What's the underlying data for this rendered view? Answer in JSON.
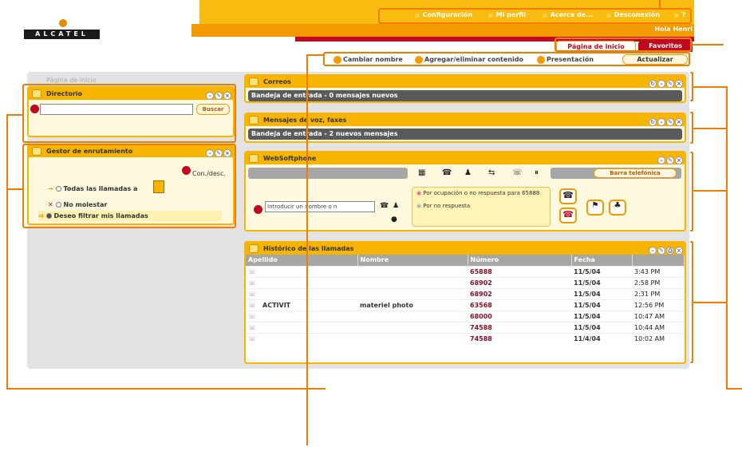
{
  "header": {
    "logo_text": "ALCATEL",
    "top_links": [
      "Configuración",
      "Mi perfil",
      "Acerca de...",
      "Desconexión",
      "?"
    ],
    "greeting": "Hola Henri",
    "tabs": [
      "Página de inicio",
      "Favoritos"
    ],
    "actions": [
      "Cambiar nombre",
      "Agregar/eliminar contenido",
      "Presentación"
    ],
    "refresh_label": "Actualizar"
  },
  "page_subtitle": "Página de inicio",
  "directorio": {
    "title": "Directorio",
    "search_button": "Buscar"
  },
  "gestor": {
    "title": "Gestor de enrutamiento",
    "toggle_label": "Con./desc.",
    "options": [
      "Todas las llamadas a",
      "No molestar",
      "Deseo filtrar mis llamadas"
    ]
  },
  "correos": {
    "title": "Correos",
    "bar": "Bandeja de entrada - 0 mensajes nuevos"
  },
  "voz": {
    "title": "Mensajes de voz, faxes",
    "bar": "Bandeja de entrada - 2 nuevos mensajes"
  },
  "softphone": {
    "title": "WebSoftphone",
    "barra_label": "Barra telefónica",
    "input_placeholder": "Introducir un nombre o n",
    "forward_rules": [
      "Por ocupación o no respuesta para 65888",
      "Por no respuesta"
    ]
  },
  "historico": {
    "title": "Histórico de las llamadas",
    "columns": [
      "Apellido",
      "Nombre",
      "Número",
      "Fecha",
      ""
    ],
    "rows": [
      {
        "apellido": "",
        "nombre": "",
        "numero": "65888",
        "fecha": "11/5/04",
        "hora": "3:43 PM"
      },
      {
        "apellido": "",
        "nombre": "",
        "numero": "68902",
        "fecha": "11/5/04",
        "hora": "2:58 PM"
      },
      {
        "apellido": "",
        "nombre": "",
        "numero": "68902",
        "fecha": "11/5/04",
        "hora": "2:31 PM"
      },
      {
        "apellido": "ACTIVIT",
        "nombre": "materiel photo",
        "numero": "63568",
        "fecha": "11/5/04",
        "hora": "12:56 PM"
      },
      {
        "apellido": "",
        "nombre": "",
        "numero": "68000",
        "fecha": "11/5/04",
        "hora": "10:47 AM"
      },
      {
        "apellido": "",
        "nombre": "",
        "numero": "74588",
        "fecha": "11/5/04",
        "hora": "10:44 AM"
      },
      {
        "apellido": "",
        "nombre": "",
        "numero": "74588",
        "fecha": "11/4/04",
        "hora": "10:02 AM"
      }
    ]
  },
  "colors": {
    "accent": "#f7b400",
    "brand_red": "#c0081f",
    "callout": "#f07c00"
  }
}
